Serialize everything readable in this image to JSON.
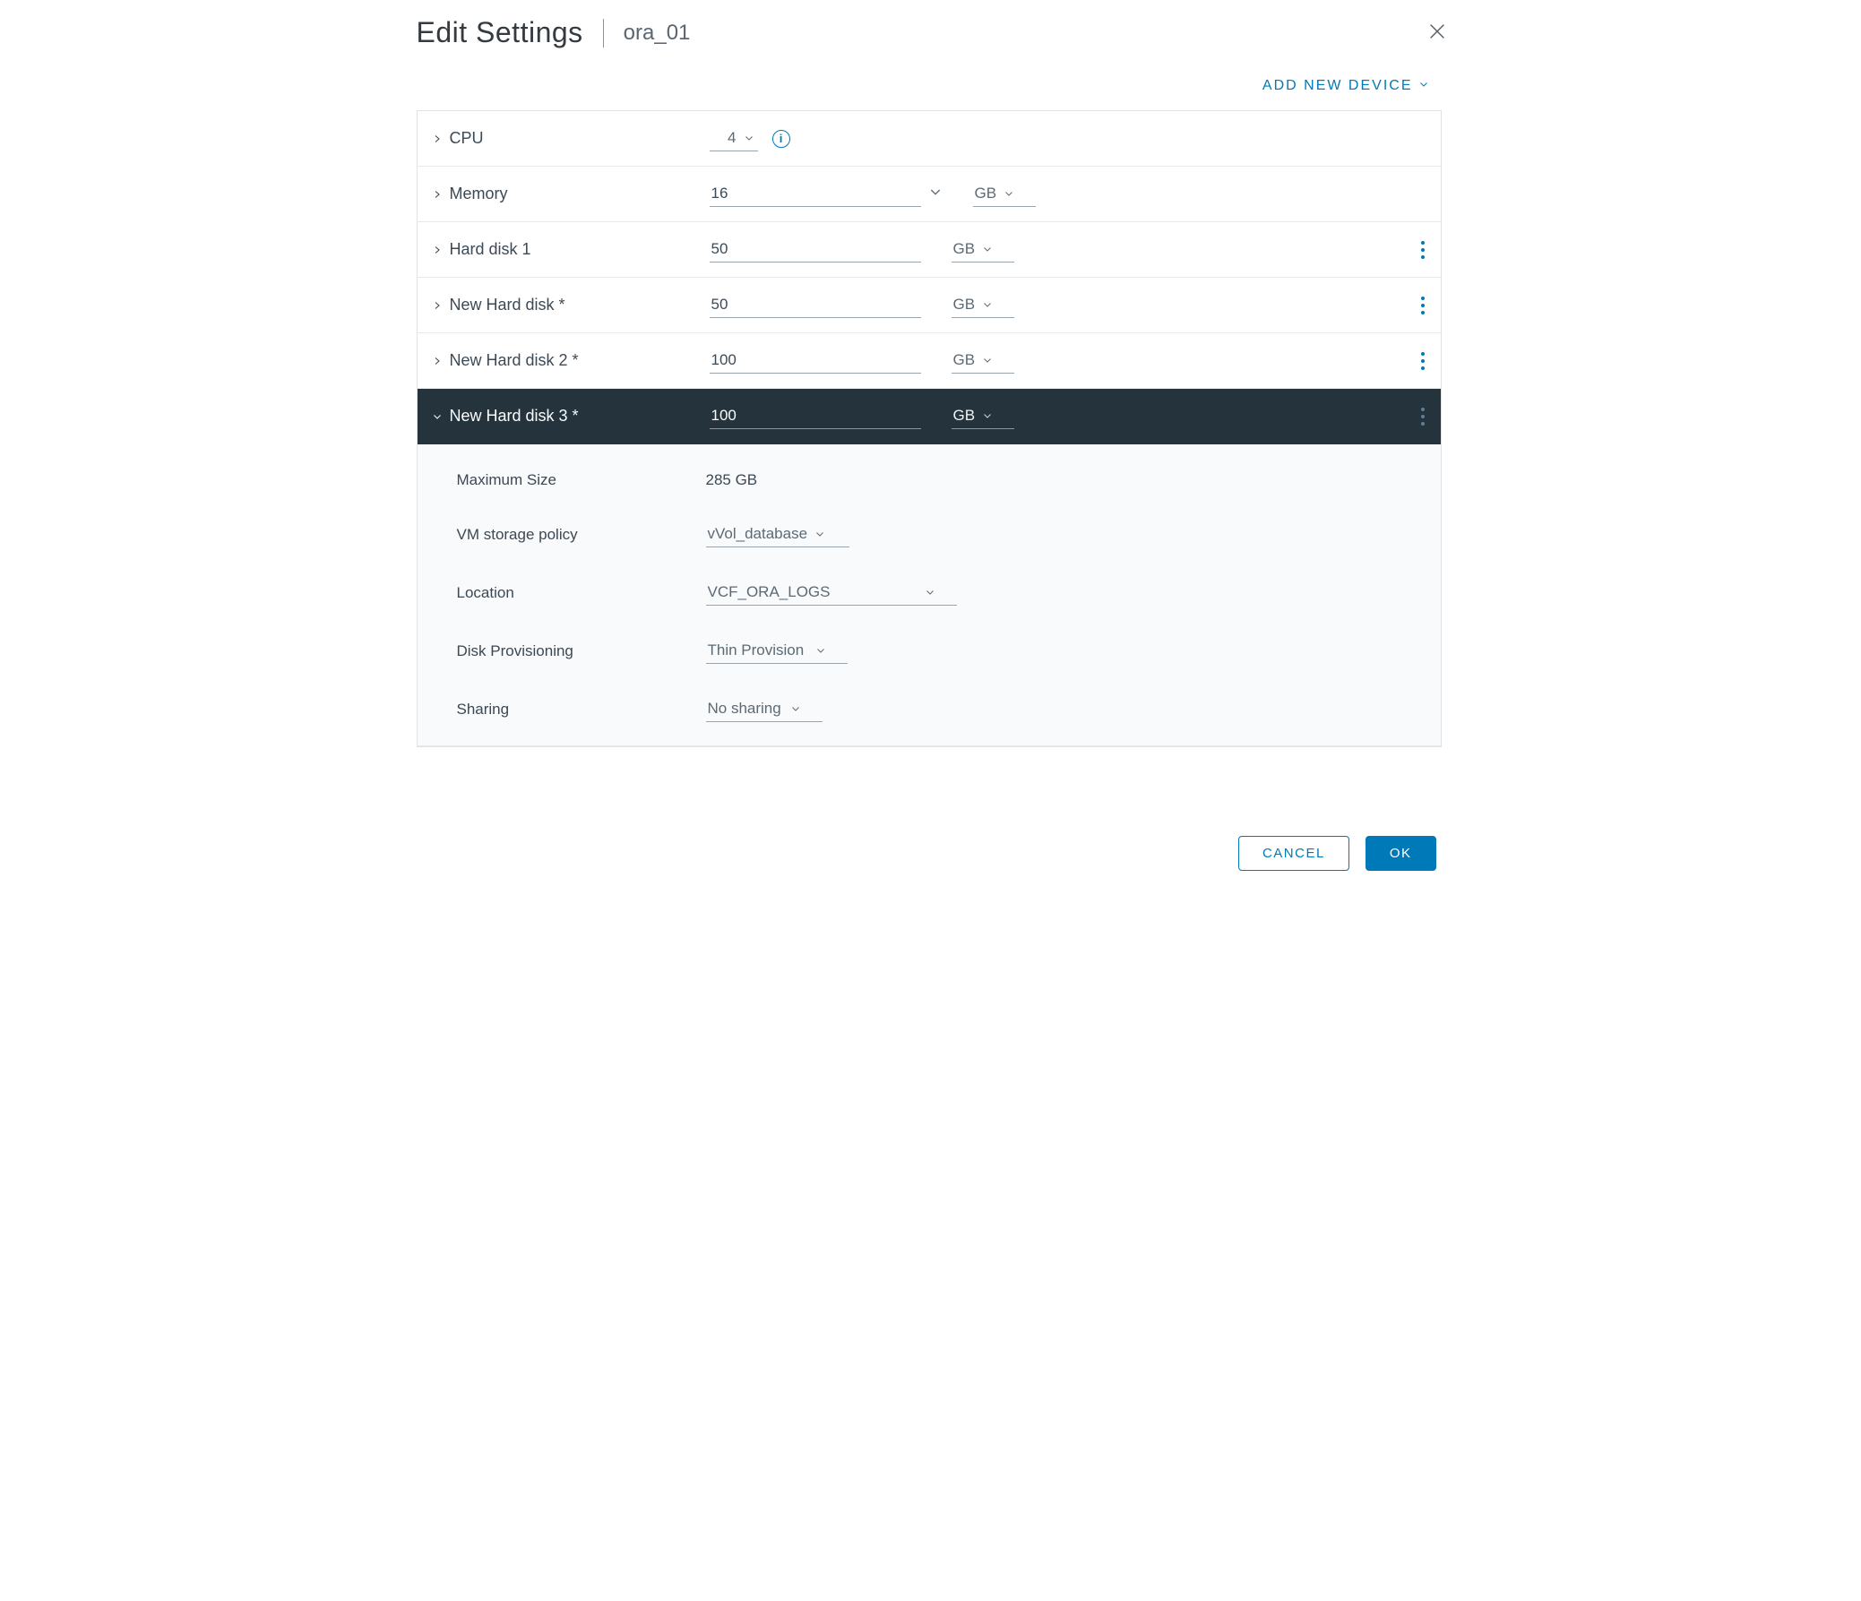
{
  "header": {
    "title": "Edit Settings",
    "subtitle": "ora_01"
  },
  "toolbar": {
    "add_device_label": "ADD NEW DEVICE"
  },
  "hardware": {
    "cpu": {
      "label": "CPU",
      "value": "4"
    },
    "memory": {
      "label": "Memory",
      "value": "16",
      "unit": "GB"
    },
    "disks": [
      {
        "label": "Hard disk 1",
        "value": "50",
        "unit": "GB"
      },
      {
        "label": "New Hard disk *",
        "value": "50",
        "unit": "GB"
      },
      {
        "label": "New Hard disk 2 *",
        "value": "100",
        "unit": "GB"
      }
    ],
    "expanded_disk": {
      "label": "New Hard disk 3 *",
      "value": "100",
      "unit": "GB",
      "details": {
        "max_size_label": "Maximum Size",
        "max_size_value": "285 GB",
        "storage_policy_label": "VM storage policy",
        "storage_policy_value": "vVol_database",
        "location_label": "Location",
        "location_value": "VCF_ORA_LOGS",
        "provisioning_label": "Disk Provisioning",
        "provisioning_value": "Thin Provision",
        "sharing_label": "Sharing",
        "sharing_value": "No sharing"
      }
    }
  },
  "footer": {
    "cancel_label": "CANCEL",
    "ok_label": "OK"
  }
}
